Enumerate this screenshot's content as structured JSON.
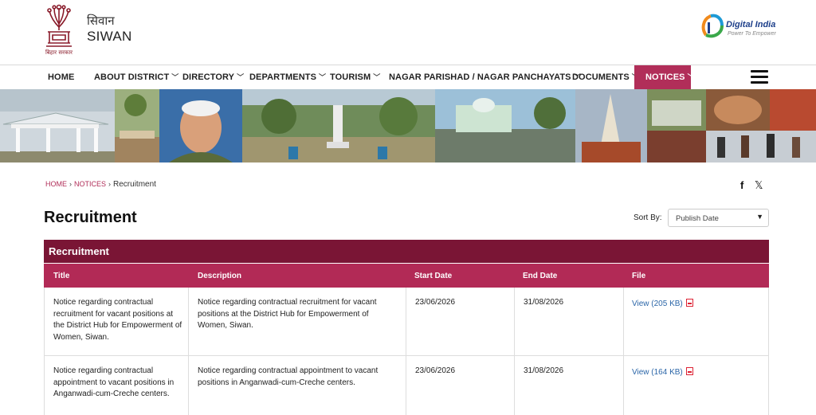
{
  "header": {
    "site_name_hindi": "सिवान",
    "site_name": "SIWAN",
    "emblem_caption": "बिहार सरकार",
    "digital_india_title": "Digital India",
    "digital_india_tagline": "Power To Empower"
  },
  "nav": {
    "items": [
      {
        "label": "HOME",
        "has_dropdown": false
      },
      {
        "label": "ABOUT DISTRICT",
        "has_dropdown": true
      },
      {
        "label": "DIRECTORY",
        "has_dropdown": true
      },
      {
        "label": "DEPARTMENTS",
        "has_dropdown": true
      },
      {
        "label": "TOURISM",
        "has_dropdown": true
      },
      {
        "label": "NAGAR PARISHAD / NAGAR PANCHAYATS",
        "has_dropdown": true
      },
      {
        "label": "DOCUMENTS",
        "has_dropdown": true
      },
      {
        "label": "NOTICES",
        "has_dropdown": true,
        "active": true
      }
    ],
    "active_color": "#b12e59",
    "chevron_icon": "chevron-down-icon",
    "menu_icon": "hamburger-menu-icon"
  },
  "breadcrumb": {
    "home": "HOME",
    "notices": "NOTICES",
    "current": "Recruitment",
    "separator": "›"
  },
  "share": {
    "facebook_icon": "facebook-icon",
    "facebook_glyph": "f",
    "x_icon": "x-icon",
    "x_glyph": "𝕏"
  },
  "page": {
    "title": "Recruitment",
    "sort_label": "Sort By:",
    "sort_value": "Publish Date"
  },
  "table": {
    "section_title": "Recruitment",
    "section_color": "#7a1535",
    "header_color": "#b22a56",
    "columns": [
      "Title",
      "Description",
      "Start Date",
      "End Date",
      "File"
    ],
    "rows": [
      {
        "title": "Notice regarding contractual recruitment for vacant positions at the District Hub for Empowerment of Women, Siwan.",
        "description": "Notice regarding contractual recruitment for vacant positions at the District Hub for Empowerment of Women, Siwan.",
        "start_date": "23/06/2026",
        "end_date": "31/08/2026",
        "file_label": "View (205 KB)",
        "file_icon": "pdf-icon"
      },
      {
        "title": "Notice regarding contractual appointment to vacant positions in Anganwadi-cum-Creche centers.",
        "description": "Notice regarding contractual appointment to vacant positions in Anganwadi-cum-Creche centers.",
        "start_date": "23/06/2026",
        "end_date": "31/08/2026",
        "file_label": "View (164 KB)",
        "file_icon": "pdf-icon"
      }
    ]
  }
}
